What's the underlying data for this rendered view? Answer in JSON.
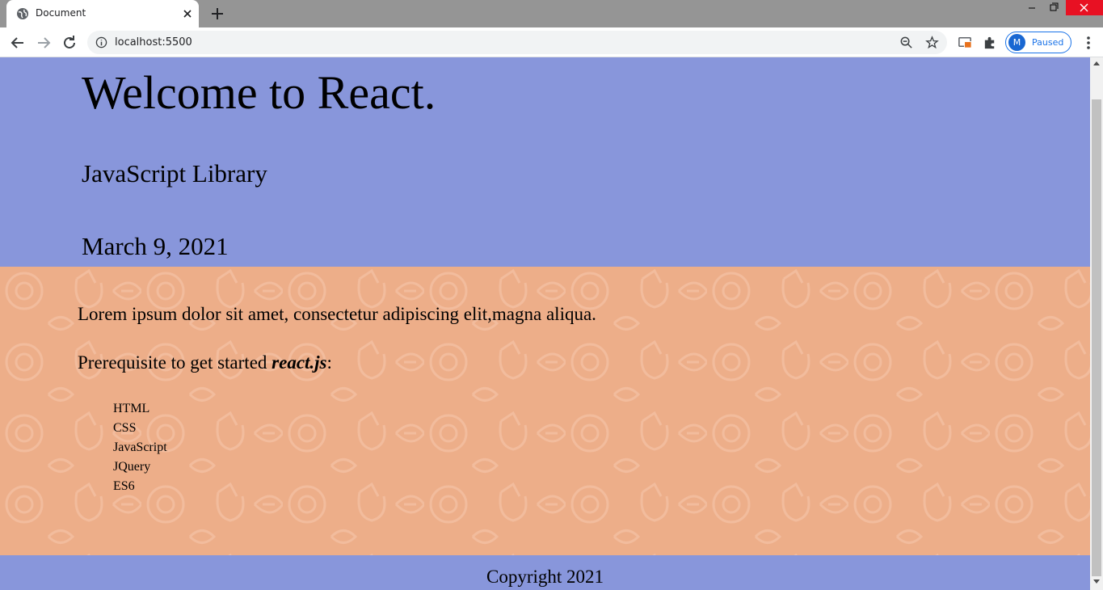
{
  "browser": {
    "tab": {
      "title": "Document",
      "favicon": "globe-icon",
      "close_icon": "close-icon"
    },
    "new_tab_icon": "plus-icon",
    "nav": {
      "back_icon": "arrow-left-icon",
      "forward_icon": "arrow-right-icon",
      "reload_icon": "reload-icon"
    },
    "omnibox": {
      "url": "localhost:5500",
      "info_icon": "info-icon",
      "zoom_icon": "zoom-out-icon",
      "star_icon": "star-icon"
    },
    "toolbar_icons": [
      "cast-icon",
      "puzzle-icon"
    ],
    "profile": {
      "initial": "M",
      "status": "Paused"
    },
    "menu_icon": "kebab-menu-icon",
    "window_controls": [
      "minimize-icon",
      "restore-icon",
      "close-icon"
    ]
  },
  "page": {
    "header": {
      "title": "Welcome to React.",
      "subtitle": "JavaScript Library",
      "date": "March 9, 2021"
    },
    "main": {
      "intro": "Lorem ipsum dolor sit amet, consectetur adipiscing elit,magna aliqua.",
      "prereq_text": "Prerequisite to get started ",
      "prereq_emph": "react.js",
      "prereq_suffix": ":",
      "list": [
        "HTML",
        "CSS",
        "JavaScript",
        "JQuery",
        "ES6"
      ]
    },
    "footer": {
      "copyright": "Copyright 2021"
    }
  },
  "colors": {
    "header_bg": "#8896db",
    "main_bg": "#edae89",
    "footer_bg": "#8896db",
    "tabstrip_bg": "#959595",
    "profile_accent": "#1a73e8"
  }
}
